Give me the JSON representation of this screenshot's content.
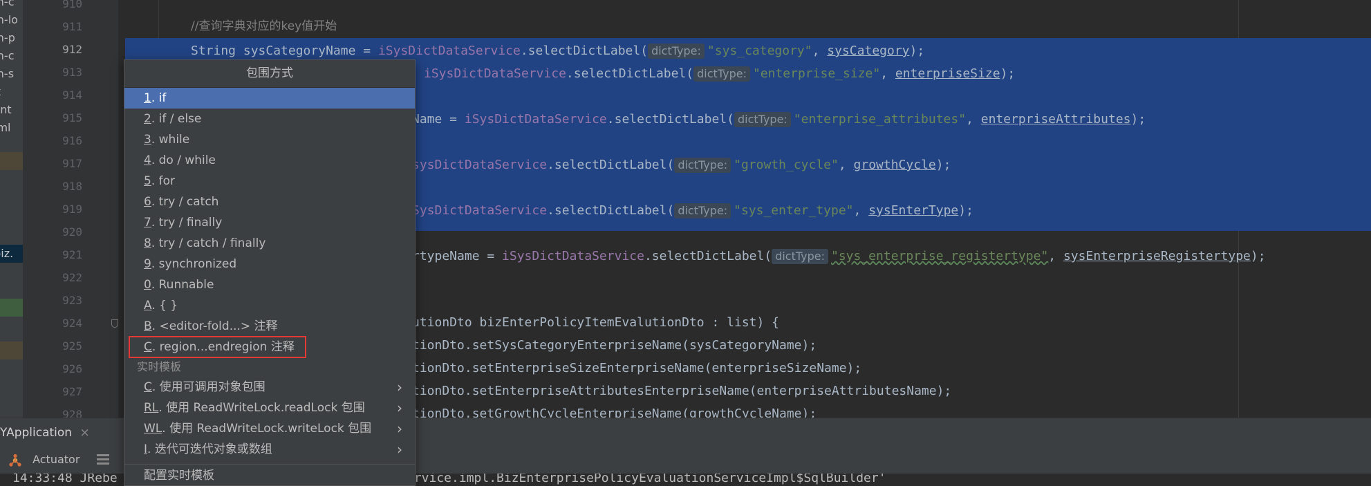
{
  "project_tree": {
    "items": [
      "on-c",
      "on-lo",
      "on-p",
      "on-c",
      "on-s",
      "ct",
      "ient",
      "xml",
      "",
      "",
      "",
      "",
      "",
      "",
      ".biz.",
      "",
      "",
      "",
      ""
    ]
  },
  "gutter": {
    "line_numbers": [
      "910",
      "911",
      "912",
      "913",
      "914",
      "915",
      "916",
      "917",
      "918",
      "919",
      "920",
      "921",
      "922",
      "923",
      "924",
      "925",
      "926",
      "927",
      "928"
    ],
    "current_line": "912"
  },
  "editor": {
    "comment_line": "//查询字典对应的key值开始",
    "lines": [
      {
        "prefix_kw": "String ",
        "prefix": "sysCategoryName = ",
        "obj": "iSysDictDataService",
        "call": ".selectDictLabel(",
        "hint": "dictType:",
        "str": "\"sys_category\"",
        "sep": ", ",
        "arg": "sysCategory",
        "end": ");"
      },
      {
        "prefix_kw": "",
        "prefix": "",
        "obj": "iSysDictDataService",
        "call": ".selectDictLabel(",
        "hint": "dictType:",
        "str": "\"enterprise_size\"",
        "sep": ", ",
        "arg": "enterpriseSize",
        "end": ");"
      },
      {
        "prefix_kw": "",
        "prefix": "Name = ",
        "obj": "iSysDictDataService",
        "call": ".selectDictLabel(",
        "hint": "dictType:",
        "str": "\"enterprise_attributes\"",
        "sep": ", ",
        "arg": "enterpriseAttributes",
        "end": ");"
      },
      {
        "prefix_kw": "",
        "prefix": "",
        "obj": "sysDictDataService",
        "call": ".selectDictLabel(",
        "hint": "dictType:",
        "str": "\"growth_cycle\"",
        "sep": ", ",
        "arg": "growthCycle",
        "end": ");"
      },
      {
        "prefix_kw": "",
        "prefix": "",
        "obj": "SysDictDataService",
        "call": ".selectDictLabel(",
        "hint": "dictType:",
        "str": "\"sys_enter_type\"",
        "sep": ", ",
        "arg": "sysEnterType",
        "end": ");"
      },
      {
        "prefix_kw": "",
        "prefix": "rtypeName = ",
        "obj": "iSysDictDataService",
        "call": ".selectDictLabel(",
        "hint": "dictType:",
        "str": "\"sys_enterprise_registertype\"",
        "sep": ", ",
        "arg": "sysEnterpriseRegistertype",
        "end": ");"
      }
    ],
    "loop_line": "utionDto bizEnterPolicyItemEvalutionDto : list) {",
    "body_lines": [
      "tionDto.setSysCategoryEnterpriseName(sysCategoryName);",
      "tionDto.setEnterpriseSizeEnterpriseName(enterpriseSizeName);",
      "tionDto.setEnterpriseAttributesEnterpriseName(enterpriseAttributesName);",
      "tionDto.setGrowthCycleEnterpriseName(growthCycleName);"
    ]
  },
  "popup": {
    "title": "包围方式",
    "items": [
      {
        "key": "1",
        "label": ". if",
        "selected": true
      },
      {
        "key": "2",
        "label": ". if / else"
      },
      {
        "key": "3",
        "label": ". while"
      },
      {
        "key": "4",
        "label": ". do / while"
      },
      {
        "key": "5",
        "label": ". for"
      },
      {
        "key": "6",
        "label": ". try / catch"
      },
      {
        "key": "7",
        "label": ". try / finally"
      },
      {
        "key": "8",
        "label": ". try / catch / finally"
      },
      {
        "key": "9",
        "label": ". synchronized"
      },
      {
        "key": "0",
        "label": ". Runnable"
      },
      {
        "key": "A",
        "label": ". { }"
      },
      {
        "key": "B",
        "label": ". <editor-fold...> 注释"
      },
      {
        "key": "C",
        "label": ". region...endregion 注释",
        "highlighted": true
      }
    ],
    "section_label": "实时模板",
    "template_items": [
      {
        "key": "C",
        "label": ". 使用可调用对象包围",
        "submenu": true
      },
      {
        "key": "RL",
        "label": ". 使用 ReadWriteLock.readLock 包围",
        "submenu": true
      },
      {
        "key": "WL",
        "label": ". 使用 ReadWriteLock.writeLock 包围",
        "submenu": true
      },
      {
        "key": "I",
        "label": ". 迭代可迭代对象或数组",
        "submenu": true
      }
    ],
    "footer_item": "配置实时模板"
  },
  "run_bar": {
    "tab_label": "YApplication",
    "close_glyph": "×"
  },
  "tool_row": {
    "actuator_label": "Actuator"
  },
  "console": {
    "left_text": "14:33:48 JRebe",
    "right_text": "ervice.impl.BizEnterprisePolicyEvaluationServiceImpl$SqlBuilder'"
  },
  "colors": {
    "selection": "#214283",
    "popup_selected": "#4b6eaf",
    "highlight_box": "#e53935",
    "string": "#6a8759",
    "field": "#9876aa",
    "keyword": "#cc7832"
  }
}
